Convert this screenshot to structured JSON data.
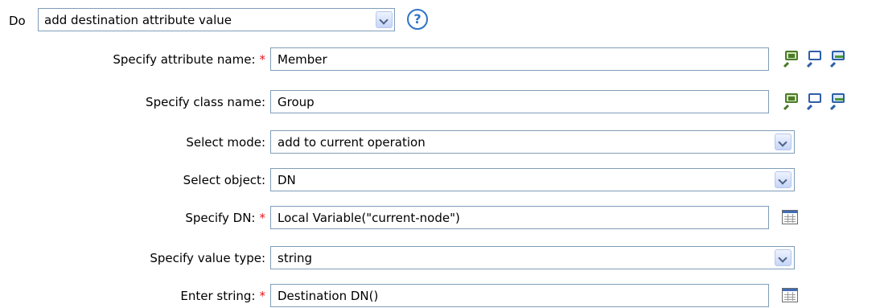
{
  "header": {
    "do_label": "Do",
    "action_value": "add destination attribute value",
    "help_glyph": "?"
  },
  "rows": [
    {
      "label": "Specify attribute name:",
      "required": true,
      "value": "Member",
      "kind": "text",
      "icons": [
        "browse-attribute-icon",
        "browse-schema-icon",
        "browse-server-icon"
      ]
    },
    {
      "label": "Specify class name:",
      "required": false,
      "value": "Group",
      "kind": "text",
      "icons": [
        "browse-class-icon",
        "browse-schema-icon",
        "browse-server-icon"
      ]
    },
    {
      "label": "Select mode:",
      "required": false,
      "value": "add to current operation",
      "kind": "select"
    },
    {
      "label": "Select object:",
      "required": false,
      "value": "DN",
      "kind": "select"
    },
    {
      "label": "Specify DN:",
      "required": true,
      "value": "Local Variable(\"current-node\")",
      "kind": "text",
      "icons": [
        "argument-builder-icon"
      ]
    },
    {
      "label": "Specify value type:",
      "required": false,
      "value": "string",
      "kind": "select"
    },
    {
      "label": "Enter string:",
      "required": true,
      "value": "Destination DN()",
      "kind": "text",
      "icons": [
        "argument-builder-icon"
      ]
    }
  ],
  "required_marker": "*",
  "colors": {
    "border": "#7f9db9",
    "required": "#e8141c",
    "help": "#2f74c7"
  }
}
